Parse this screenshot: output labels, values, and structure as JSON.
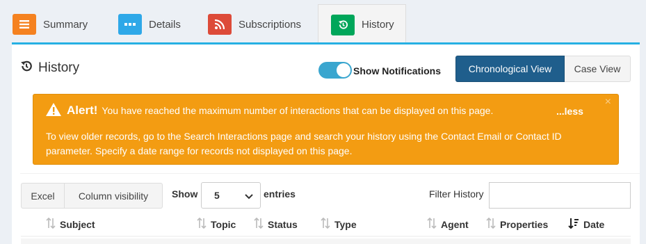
{
  "tabs": [
    {
      "label": "Summary",
      "color": "#f58220",
      "icon": "bars-icon"
    },
    {
      "label": "Details",
      "color": "#2ea8e8",
      "icon": "ellipsis-icon"
    },
    {
      "label": "Subscriptions",
      "color": "#dd4b39",
      "icon": "rss-icon"
    },
    {
      "label": "History",
      "color": "#00a65a",
      "icon": "history-icon"
    }
  ],
  "panel": {
    "title": "History",
    "toggle_label": "Show Notifications",
    "toggle_on": true,
    "view_buttons": {
      "chronological": "Chronological View",
      "case": "Case View"
    },
    "accent_color": "#26b0e3"
  },
  "alert": {
    "heading": "Alert!",
    "message": "You have reached the maximum number of interactions that can be displayed on this page.",
    "toggle_text": "...less",
    "close": "×",
    "body": "To view older records, go to the Search Interactions page and search your history using the Contact Email or Contact ID parameter. Specify a date range for records not displayed on this page.",
    "color": "#f39c12"
  },
  "table_controls": {
    "excel_label": "Excel",
    "colvis_label": "Column visibility",
    "show_label": "Show",
    "page_size": "5",
    "entries_label": "entries",
    "filter_label": "Filter History",
    "filter_value": ""
  },
  "table": {
    "columns": [
      "Subject",
      "Topic",
      "Status",
      "Type",
      "Agent",
      "Properties",
      "Date"
    ]
  }
}
